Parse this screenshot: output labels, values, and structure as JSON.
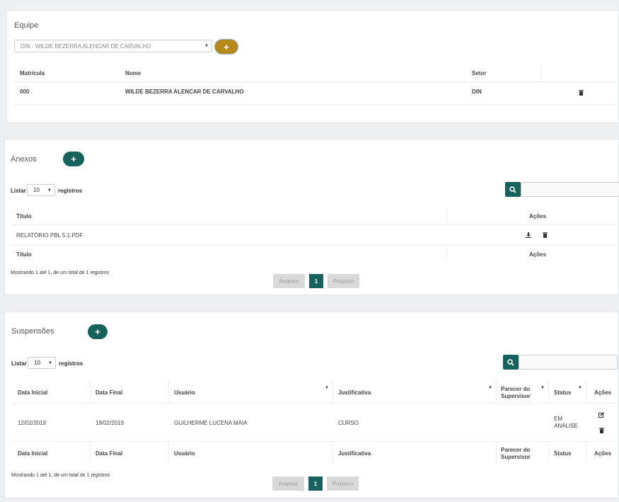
{
  "equipe": {
    "title": "Equipe",
    "select_value": "DIN - WILDE BEZERRA ALENCAR DE CARVALHO",
    "add_label": "+",
    "headers": [
      "Matrícula",
      "Nome",
      "Setor"
    ],
    "row": {
      "matricula": "000",
      "nome": "WILDE BEZERRA ALENCAR DE CARVALHO",
      "setor": "DIN"
    }
  },
  "anexos": {
    "title": "Anexos",
    "add_label": "+",
    "listar": "Listar",
    "page_size": "10",
    "registros": "registros",
    "headers": [
      "Título",
      "Ações"
    ],
    "rows": [
      {
        "titulo": "RELATÓRIO PBL 5.1.PDF"
      }
    ],
    "info": "Mostrando 1 até 1, de um total de 1 registros",
    "pager": {
      "prev": "Anterior",
      "page": "1",
      "next": "Próximo"
    }
  },
  "suspensoes": {
    "title": "Suspensões",
    "add_label": "+",
    "listar": "Listar",
    "page_size": "10",
    "registros": "registros",
    "headers": [
      "Data Inicial",
      "Data Final",
      "Usuário",
      "Justificativa",
      "Parecer do Supervisor",
      "Status",
      "Ações"
    ],
    "rows": [
      {
        "data_inicial": "12/02/2019",
        "data_final": "19/02/2019",
        "usuario": "GUILHERME LUCENA MAIA",
        "justificativa": "CURSO",
        "parecer": "",
        "status": "EM ANÁLISE"
      }
    ],
    "info": "Mostrando 1 até 1, de um total de 1 registros",
    "pager": {
      "prev": "Anterior",
      "page": "1",
      "next": "Próximo"
    }
  },
  "colors": {
    "teal": "#17625c",
    "gold": "#b5891a"
  },
  "icons": [
    "trash-icon",
    "download-icon",
    "search-icon",
    "edit-icon",
    "sort-caret-icon"
  ]
}
